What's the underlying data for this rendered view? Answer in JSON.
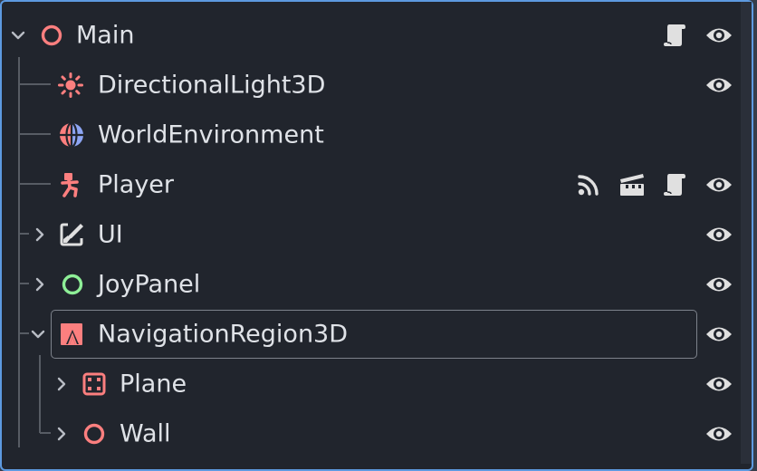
{
  "colors": {
    "panel_bg": "#21252d",
    "border_accent": "#5d9ae0",
    "node3d_red": "#fc7f7f",
    "control_green": "#8eef97",
    "text": "#dfe2e7",
    "icon_light": "#e0e0e0"
  },
  "tree": {
    "nodes": [
      {
        "name": "Main",
        "icon": "node3d-circle-icon",
        "expanded": true,
        "actions": [
          "script-icon",
          "visibility-eye-icon"
        ]
      },
      {
        "name": "DirectionalLight3D",
        "icon": "directional-light-icon",
        "actions": [
          "visibility-eye-icon"
        ]
      },
      {
        "name": "WorldEnvironment",
        "icon": "world-environment-icon",
        "actions": []
      },
      {
        "name": "Player",
        "icon": "character-body-icon",
        "actions": [
          "signals-icon",
          "scene-instance-icon",
          "script-icon",
          "visibility-eye-icon"
        ]
      },
      {
        "name": "UI",
        "icon": "control-icon",
        "expanded": false,
        "actions": [
          "visibility-eye-icon"
        ]
      },
      {
        "name": "JoyPanel",
        "icon": "control-circle-icon",
        "expanded": false,
        "actions": [
          "visibility-eye-icon"
        ]
      },
      {
        "name": "NavigationRegion3D",
        "icon": "navigation-region-icon",
        "expanded": true,
        "selected": true,
        "actions": [
          "visibility-eye-icon"
        ]
      },
      {
        "name": "Plane",
        "icon": "mesh-instance-icon",
        "expanded": false,
        "actions": [
          "visibility-eye-icon"
        ]
      },
      {
        "name": "Wall",
        "icon": "node3d-circle-icon",
        "expanded": false,
        "actions": [
          "visibility-eye-icon"
        ]
      }
    ]
  }
}
